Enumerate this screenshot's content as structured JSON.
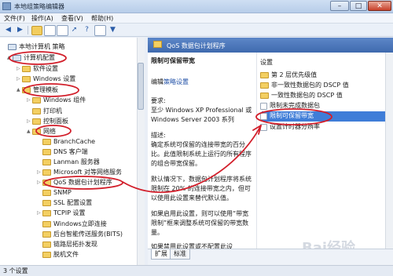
{
  "window": {
    "title": "本地组策略编辑器",
    "controls": {
      "minimize": "–",
      "maximize": "□",
      "close": "✕"
    }
  },
  "menu": [
    "文件(F)",
    "操作(A)",
    "查看(V)",
    "帮助(H)"
  ],
  "tree": [
    {
      "label": "本地计算机 策略",
      "icon": "computer-icon",
      "toggle": ""
    },
    {
      "label": "计算机配置",
      "icon": "computer-icon",
      "toggle": "▲"
    },
    {
      "label": "软件设置",
      "icon": "folder-icon",
      "toggle": "▷"
    },
    {
      "label": "Windows 设置",
      "icon": "folder-icon",
      "toggle": "▷"
    },
    {
      "label": "管理模板",
      "icon": "folder-icon",
      "toggle": "▲"
    },
    {
      "label": "Windows 组件",
      "icon": "folder-icon",
      "toggle": "▷"
    },
    {
      "label": "打印机",
      "icon": "folder-icon",
      "toggle": ""
    },
    {
      "label": "控制面板",
      "icon": "folder-icon",
      "toggle": "▷"
    },
    {
      "label": "网络",
      "icon": "folder-icon",
      "toggle": "▲"
    },
    {
      "label": "BranchCache",
      "icon": "folder-icon",
      "toggle": ""
    },
    {
      "label": "DNS 客户端",
      "icon": "folder-icon",
      "toggle": ""
    },
    {
      "label": "Lanman 服务器",
      "icon": "folder-icon",
      "toggle": ""
    },
    {
      "label": "Microsoft 对等网络服务",
      "icon": "folder-icon",
      "toggle": "▷"
    },
    {
      "label": "QoS 数据包计划程序",
      "icon": "folder-open-icon",
      "toggle": "▷"
    },
    {
      "label": "SNMP",
      "icon": "folder-icon",
      "toggle": ""
    },
    {
      "label": "SSL 配置设置",
      "icon": "folder-icon",
      "toggle": ""
    },
    {
      "label": "TCPIP 设置",
      "icon": "folder-icon",
      "toggle": "▷"
    },
    {
      "label": "Windows立即连接",
      "icon": "folder-icon",
      "toggle": ""
    },
    {
      "label": "后台智能传送服务(BITS)",
      "icon": "folder-icon",
      "toggle": ""
    },
    {
      "label": "链路层拓扑发现",
      "icon": "folder-icon",
      "toggle": ""
    },
    {
      "label": "脱机文件",
      "icon": "folder-icon",
      "toggle": ""
    }
  ],
  "detail": {
    "header": "QoS 数据包计划程序",
    "desc_title": "限制可保留带宽",
    "edit_prefix": "编辑",
    "edit_link": "策略设置",
    "requirements_label": "要求:",
    "requirements_text": "至少 Windows XP Professional 或 Windows Server 2003 系列",
    "description_label": "描述:",
    "description_text": "确定系统可保留的连接带宽的百分比。此值限制系统上运行的所有程序的组合带宽保留。",
    "default_text": "默认情况下，数据包计划程序将系统限制在 20% 的连接带宽之内，但可以使用此设置来替代默认值。",
    "enabled_text": "如果启用此设置，则可以使用“带宽限制”框来调整系统可保留的带宽数量。",
    "tail_text": "如果禁用此设置或不配置此设"
  },
  "settings": {
    "column_header": "设置",
    "items": [
      {
        "label": "第 2 层优先级值",
        "icon": "folder-icon"
      },
      {
        "label": "非一致性数据包的 DSCP 值",
        "icon": "folder-icon"
      },
      {
        "label": "一致性数据包的 DSCP 值",
        "icon": "folder-icon"
      },
      {
        "label": "限制未完成数据包",
        "icon": "setting-icon"
      },
      {
        "label": "限制可保留带宽",
        "icon": "setting-icon",
        "selected": true
      },
      {
        "label": "设置计时器分辨率",
        "icon": "setting-icon"
      }
    ]
  },
  "tabs": [
    "扩展",
    "标准"
  ],
  "status": "3 个设置",
  "watermark": "Bai经验",
  "colors": {
    "header": "#4f79bd",
    "selection": "#3f7dd8",
    "annotation": "#d21e2a"
  }
}
